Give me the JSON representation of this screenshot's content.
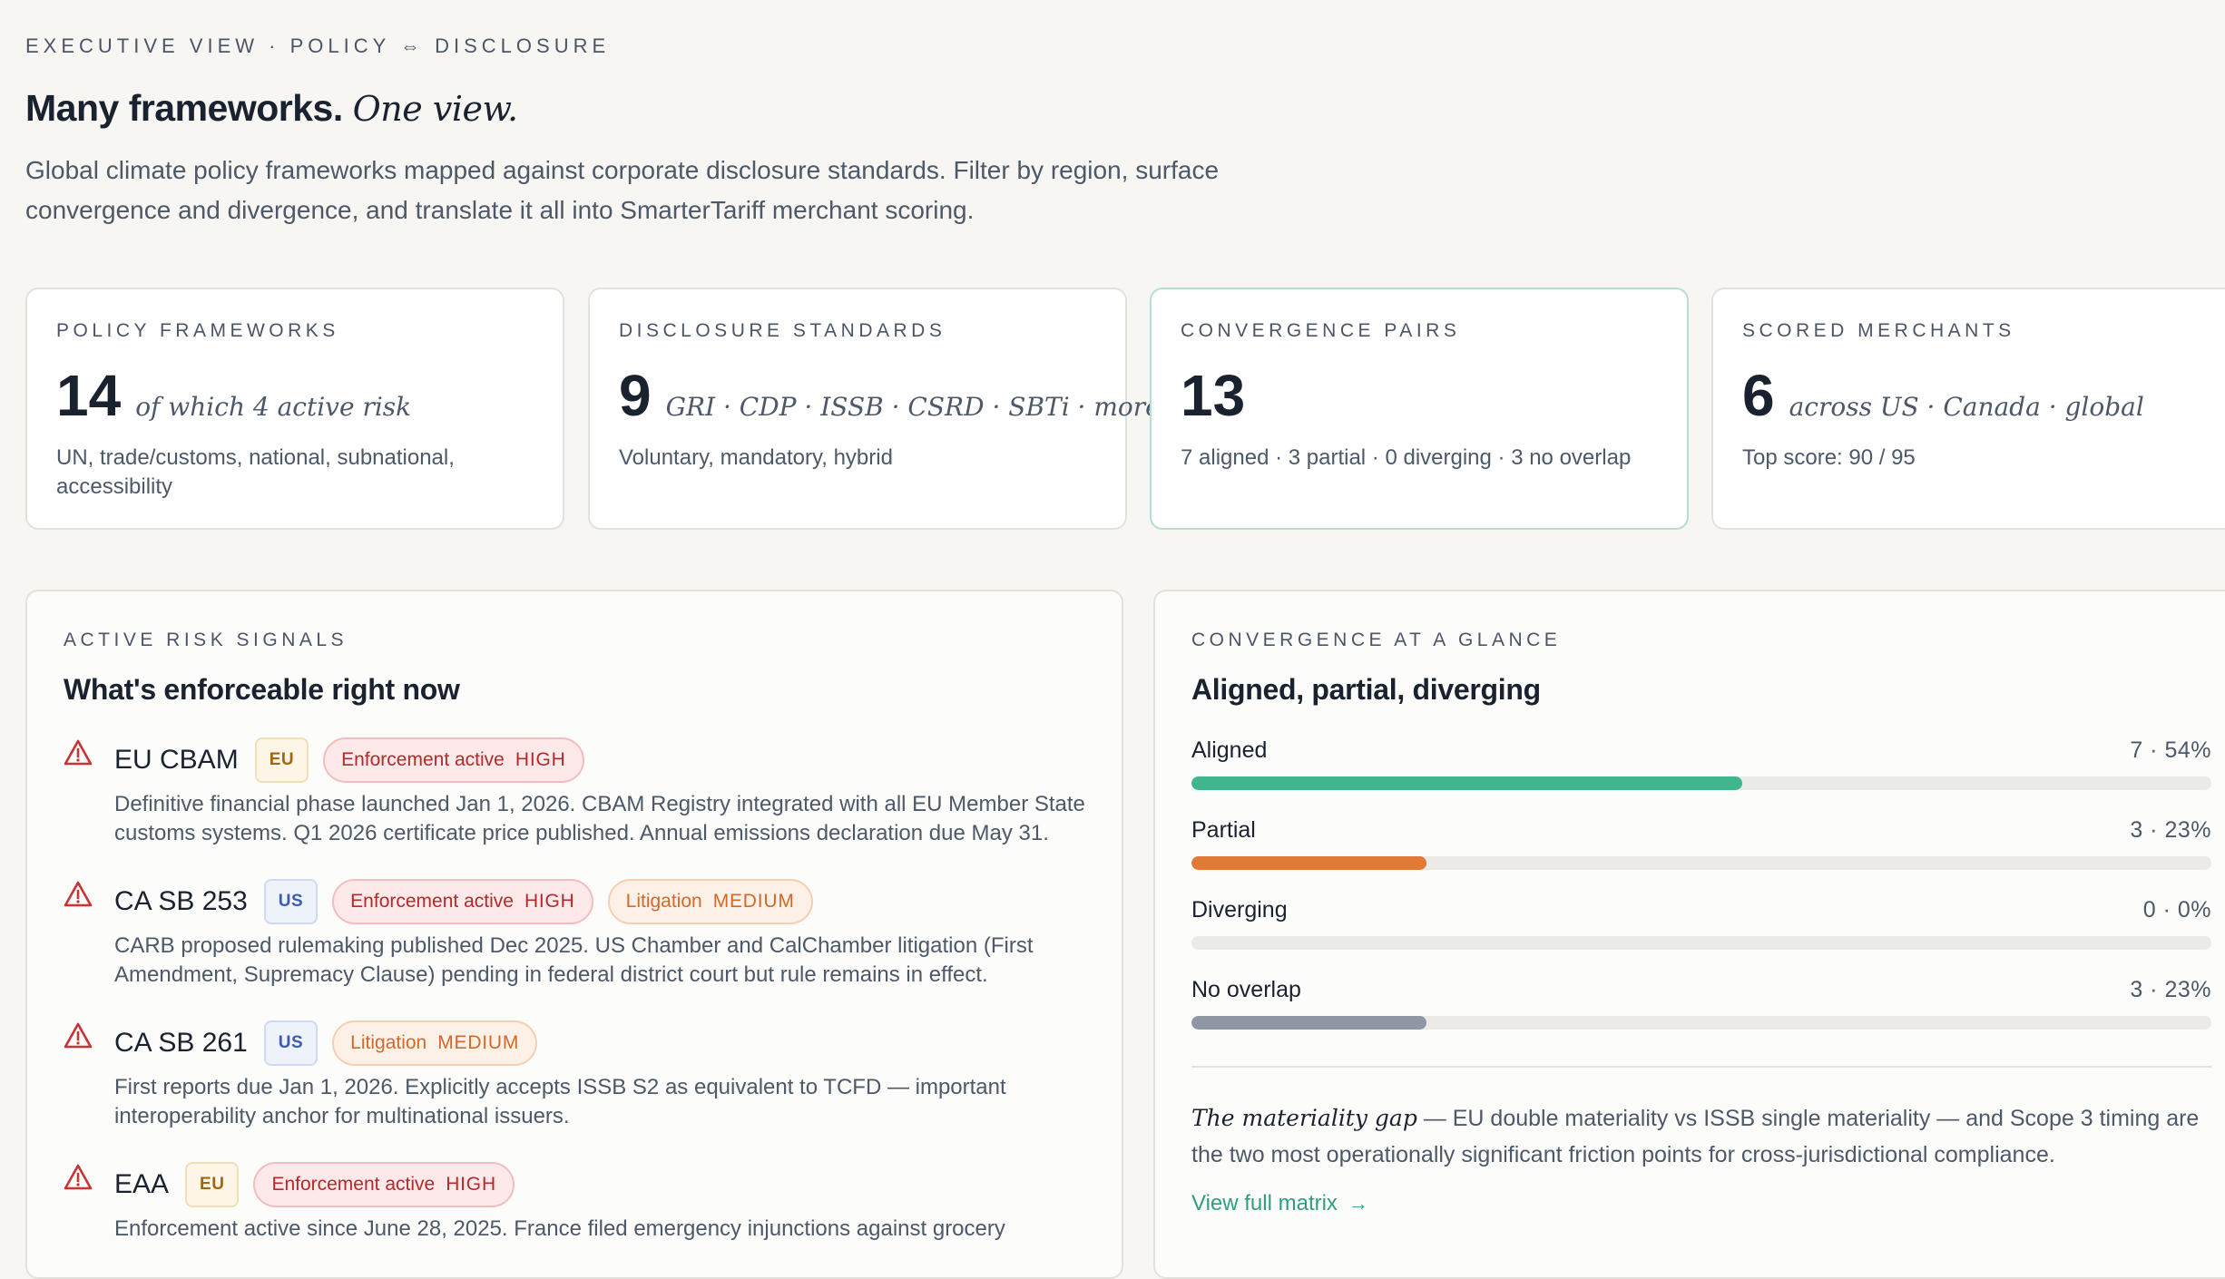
{
  "header": {
    "eyebrow": "EXECUTIVE VIEW · POLICY ⇔ DISCLOSURE",
    "title_bold": "Many frameworks.",
    "title_italic": "One view.",
    "lede": "Global climate policy frameworks mapped against corporate disclosure standards. Filter by region, surface convergence and divergence, and translate it all into SmarterTariff merchant scoring."
  },
  "stats": [
    {
      "label": "POLICY FRAMEWORKS",
      "value": "14",
      "note": "of which 4 active risk",
      "sub": "UN, trade/customs, national, subnational, accessibility"
    },
    {
      "label": "DISCLOSURE STANDARDS",
      "value": "9",
      "note": "GRI · CDP · ISSB · CSRD · SBTi · more",
      "sub": "Voluntary, mandatory, hybrid"
    },
    {
      "label": "CONVERGENCE PAIRS",
      "value": "13",
      "note": "",
      "sub": "7 aligned · 3 partial · 0 diverging · 3 no overlap"
    },
    {
      "label": "SCORED MERCHANTS",
      "value": "6",
      "note": "across US · Canada · global",
      "sub": "Top score: 90 / 95"
    }
  ],
  "risk_panel": {
    "eyebrow": "ACTIVE RISK SIGNALS",
    "title": "What's enforceable right now",
    "items": [
      {
        "name": "EU CBAM",
        "region": "EU",
        "pills": [
          {
            "label": "Enforcement active",
            "level": "HIGH",
            "severity": "high"
          }
        ],
        "desc": "Definitive financial phase launched Jan 1, 2026. CBAM Registry integrated with all EU Member State customs systems. Q1 2026 certificate price published. Annual emissions declaration due May 31."
      },
      {
        "name": "CA SB 253",
        "region": "US",
        "pills": [
          {
            "label": "Enforcement active",
            "level": "HIGH",
            "severity": "high"
          },
          {
            "label": "Litigation",
            "level": "MEDIUM",
            "severity": "medium"
          }
        ],
        "desc": "CARB proposed rulemaking published Dec 2025. US Chamber and CalChamber litigation (First Amendment, Supremacy Clause) pending in federal district court but rule remains in effect."
      },
      {
        "name": "CA SB 261",
        "region": "US",
        "pills": [
          {
            "label": "Litigation",
            "level": "MEDIUM",
            "severity": "medium"
          }
        ],
        "desc": "First reports due Jan 1, 2026. Explicitly accepts ISSB S2 as equivalent to TCFD — important interoperability anchor for multinational issuers."
      },
      {
        "name": "EAA",
        "region": "EU",
        "pills": [
          {
            "label": "Enforcement active",
            "level": "HIGH",
            "severity": "high"
          }
        ],
        "desc": "Enforcement active since June 28, 2025. France filed emergency injunctions against grocery"
      }
    ]
  },
  "convergence_panel": {
    "eyebrow": "CONVERGENCE AT A GLANCE",
    "title": "Aligned, partial, diverging",
    "rows": [
      {
        "label": "Aligned",
        "count": "7 · 54%",
        "fraction": 0.54,
        "color": "#3fb68e"
      },
      {
        "label": "Partial",
        "count": "3 · 23%",
        "fraction": 0.23,
        "color": "#e07a35"
      },
      {
        "label": "Diverging",
        "count": "0 · 0%",
        "fraction": 0.0,
        "color": "#c94a4a"
      },
      {
        "label": "No overlap",
        "count": "3 · 23%",
        "fraction": 0.23,
        "color": "#8f97a5"
      }
    ],
    "note_italic": "The materiality gap",
    "note_rest": " — EU double materiality vs ISSB single materiality — and Scope 3 timing are the two most operationally significant friction points for cross-jurisdictional compliance.",
    "link_label": "View full matrix"
  },
  "icons": {
    "risk": "warning-triangle-icon",
    "link": "arrow-right-icon"
  }
}
